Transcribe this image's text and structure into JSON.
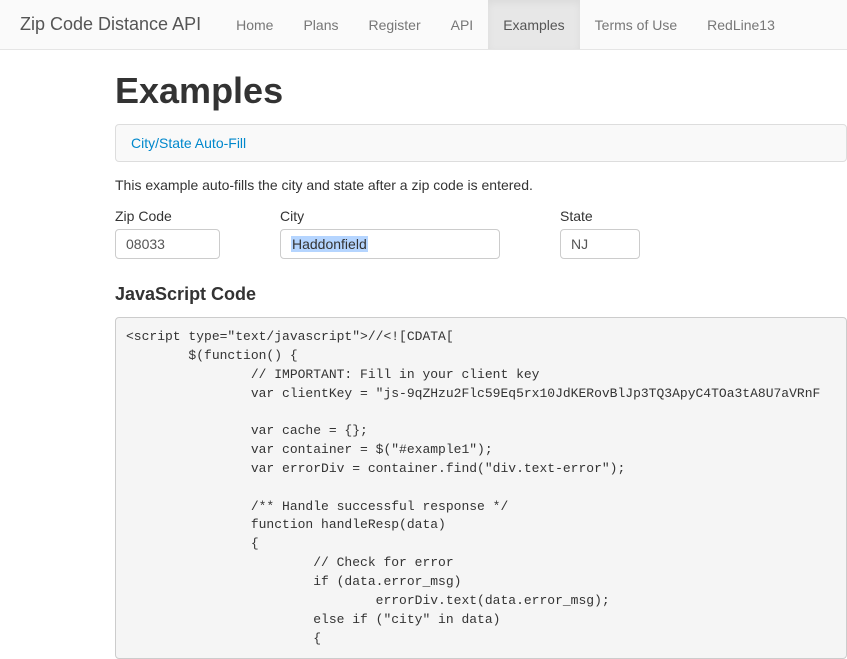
{
  "navbar": {
    "brand": "Zip Code Distance API",
    "items": [
      {
        "label": "Home",
        "active": false
      },
      {
        "label": "Plans",
        "active": false
      },
      {
        "label": "Register",
        "active": false
      },
      {
        "label": "API",
        "active": false
      },
      {
        "label": "Examples",
        "active": true
      },
      {
        "label": "Terms of Use",
        "active": false
      },
      {
        "label": "RedLine13",
        "active": false
      }
    ]
  },
  "page": {
    "title": "Examples",
    "panel_link": "City/State Auto-Fill",
    "description": "This example auto-fills the city and state after a zip code is entered."
  },
  "form": {
    "zip_label": "Zip Code",
    "zip_value": "08033",
    "city_label": "City",
    "city_value": "Haddonfield",
    "state_label": "State",
    "state_value": "NJ"
  },
  "code_section": {
    "heading": "JavaScript Code",
    "code": "<script type=\"text/javascript\">//<![CDATA[\n        $(function() {\n                // IMPORTANT: Fill in your client key\n                var clientKey = \"js-9qZHzu2Flc59Eq5rx10JdKERovBlJp3TQ3ApyC4TOa3tA8U7aVRnF\n                \n                var cache = {};\n                var container = $(\"#example1\");\n                var errorDiv = container.find(\"div.text-error\");\n                \n                /** Handle successful response */\n                function handleResp(data)\n                {\n                        // Check for error\n                        if (data.error_msg)\n                                errorDiv.text(data.error_msg);\n                        else if (\"city\" in data)\n                        {"
  }
}
